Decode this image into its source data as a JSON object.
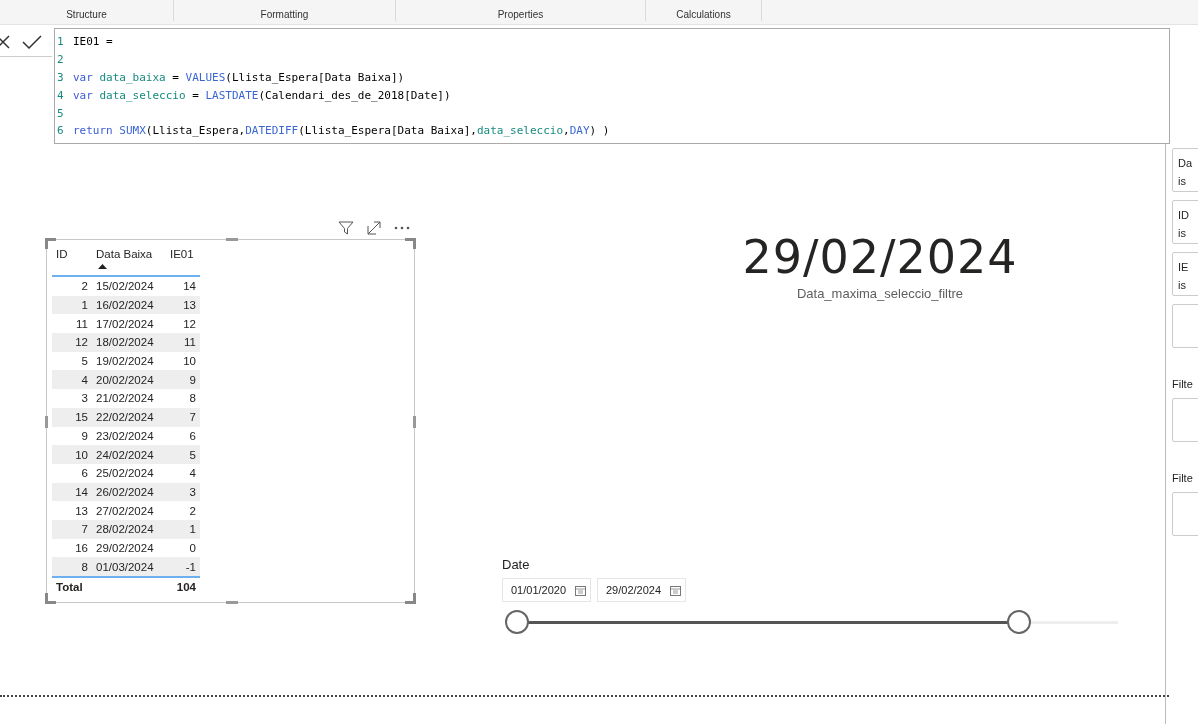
{
  "ribbon": {
    "groups": [
      "Structure",
      "Formatting",
      "Properties",
      "Calculations"
    ]
  },
  "formula_bar": {
    "lines": [
      {
        "number": "1",
        "tokens": [
          {
            "kind": "text",
            "text": "IE01 ="
          }
        ]
      },
      {
        "number": "2"
      },
      {
        "number": "3",
        "tokens": [
          {
            "kind": "keyword",
            "text": "var "
          },
          {
            "kind": "variable",
            "text": "data_baixa"
          },
          {
            "kind": "text",
            "text": " = "
          },
          {
            "kind": "function",
            "text": "VALUES"
          },
          {
            "kind": "text",
            "text": "(Llista_Espera[Data Baixa])"
          }
        ]
      },
      {
        "number": "4",
        "tokens": [
          {
            "kind": "keyword",
            "text": "var "
          },
          {
            "kind": "variable",
            "text": "data_seleccio"
          },
          {
            "kind": "text",
            "text": " = "
          },
          {
            "kind": "function",
            "text": "LASTDATE"
          },
          {
            "kind": "text",
            "text": "(Calendari_des_de_2018[Date])"
          }
        ]
      },
      {
        "number": "5"
      },
      {
        "number": "6",
        "tokens": [
          {
            "kind": "keyword",
            "text": "return "
          },
          {
            "kind": "function",
            "text": "SUMX"
          },
          {
            "kind": "text",
            "text": "(Llista_Espera,"
          },
          {
            "kind": "function",
            "text": "DATEDIFF"
          },
          {
            "kind": "text",
            "text": "(Llista_Espera[Data Baixa],"
          },
          {
            "kind": "variable",
            "text": "data_seleccio"
          },
          {
            "kind": "text",
            "text": ","
          },
          {
            "kind": "function",
            "text": "DAY"
          },
          {
            "kind": "text",
            "text": ") )"
          }
        ]
      }
    ]
  },
  "table": {
    "columns": [
      "ID",
      "Data Baixa",
      "IE01"
    ],
    "rows": [
      [
        "2",
        "15/02/2024",
        "14"
      ],
      [
        "1",
        "16/02/2024",
        "13"
      ],
      [
        "11",
        "17/02/2024",
        "12"
      ],
      [
        "12",
        "18/02/2024",
        "11"
      ],
      [
        "5",
        "19/02/2024",
        "10"
      ],
      [
        "4",
        "20/02/2024",
        "9"
      ],
      [
        "3",
        "21/02/2024",
        "8"
      ],
      [
        "15",
        "22/02/2024",
        "7"
      ],
      [
        "9",
        "23/02/2024",
        "6"
      ],
      [
        "10",
        "24/02/2024",
        "5"
      ],
      [
        "6",
        "25/02/2024",
        "4"
      ],
      [
        "14",
        "26/02/2024",
        "3"
      ],
      [
        "13",
        "27/02/2024",
        "2"
      ],
      [
        "7",
        "28/02/2024",
        "1"
      ],
      [
        "16",
        "29/02/2024",
        "0"
      ],
      [
        "8",
        "01/03/2024",
        "-1"
      ]
    ],
    "total": {
      "label": "Total",
      "value": "104"
    }
  },
  "card": {
    "value": "29/02/2024",
    "label": "Data_maxima_seleccio_filtre"
  },
  "slicer": {
    "title": "Date",
    "start": "01/01/2020",
    "end": "29/02/2024",
    "handles": [
      {
        "level": 0
      },
      {
        "level": 0.835
      }
    ]
  },
  "filter_pane": {
    "cards": [
      {
        "kind": "filter",
        "lines": [
          "Da",
          "is"
        ]
      },
      {
        "kind": "filter",
        "lines": [
          "ID",
          "is"
        ]
      },
      {
        "kind": "filter",
        "lines": [
          "IE",
          "is"
        ]
      },
      {
        "kind": "empty"
      },
      {
        "kind": "heading",
        "lines": [
          "Filte"
        ]
      },
      {
        "kind": "empty"
      },
      {
        "kind": "heading",
        "lines": [
          "Filte"
        ]
      },
      {
        "kind": "empty"
      }
    ]
  }
}
